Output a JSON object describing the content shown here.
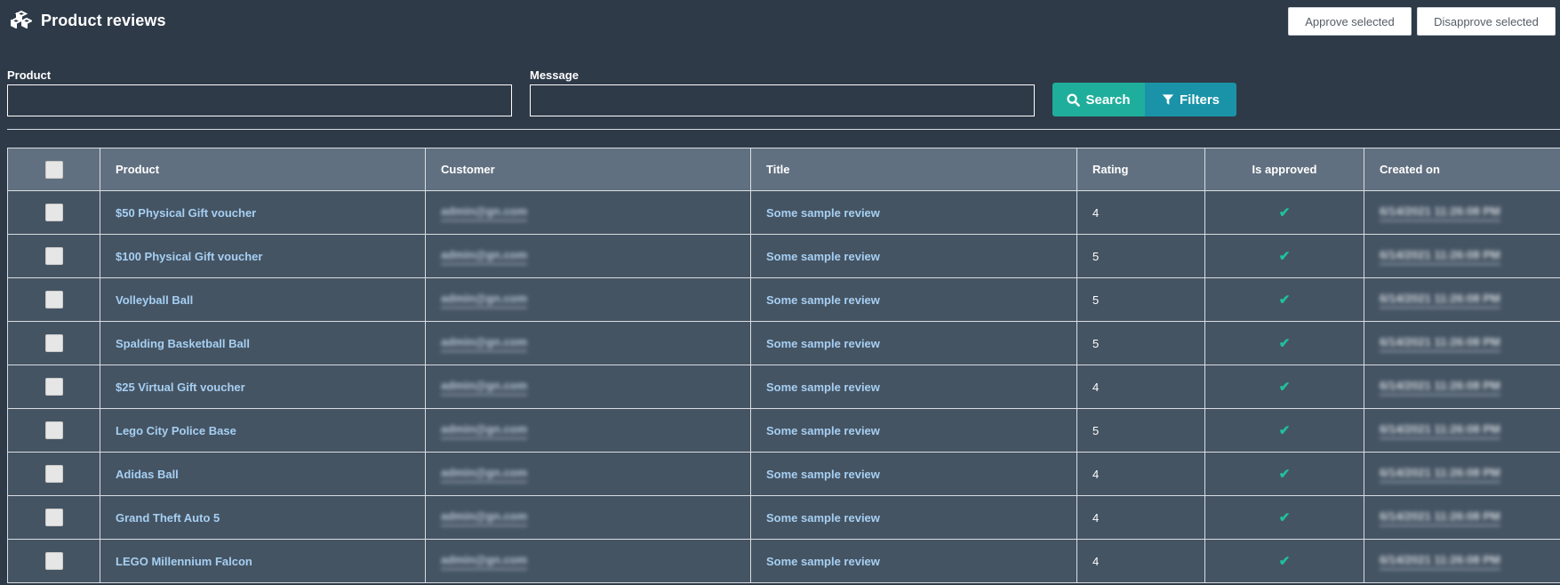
{
  "page": {
    "title": "Product reviews",
    "logo_icon": "cubes-icon"
  },
  "actions": {
    "approve_label": "Approve selected",
    "disapprove_label": "Disapprove selected"
  },
  "search": {
    "product_label": "Product",
    "product_value": "",
    "message_label": "Message",
    "message_value": "",
    "search_label": "Search",
    "filters_label": "Filters"
  },
  "colors": {
    "background": "#2e3a48",
    "header_row": "#617080",
    "body_row": "#455463",
    "search_button": "#1fae9c",
    "filters_button": "#1a93a8",
    "link": "#a6cff2",
    "approved_check": "#1fc19a"
  },
  "table": {
    "columns": [
      "Product",
      "Customer",
      "Title",
      "Rating",
      "Is approved",
      "Created on"
    ],
    "rows": [
      {
        "product": "$50 Physical Gift voucher",
        "customer": "admin@gn.com",
        "title": "Some sample review",
        "rating": "4",
        "approved": "✔",
        "created": "6/14/2021 11:26:08 PM"
      },
      {
        "product": "$100 Physical Gift voucher",
        "customer": "admin@gn.com",
        "title": "Some sample review",
        "rating": "5",
        "approved": "✔",
        "created": "6/14/2021 11:26:08 PM"
      },
      {
        "product": "Volleyball Ball",
        "customer": "admin@gn.com",
        "title": "Some sample review",
        "rating": "5",
        "approved": "✔",
        "created": "6/14/2021 11:26:08 PM"
      },
      {
        "product": "Spalding Basketball Ball",
        "customer": "admin@gn.com",
        "title": "Some sample review",
        "rating": "5",
        "approved": "✔",
        "created": "6/14/2021 11:26:08 PM"
      },
      {
        "product": "$25 Virtual Gift voucher",
        "customer": "admin@gn.com",
        "title": "Some sample review",
        "rating": "4",
        "approved": "✔",
        "created": "6/14/2021 11:26:08 PM"
      },
      {
        "product": "Lego City Police Base",
        "customer": "admin@gn.com",
        "title": "Some sample review",
        "rating": "5",
        "approved": "✔",
        "created": "6/14/2021 11:26:08 PM"
      },
      {
        "product": "Adidas Ball",
        "customer": "admin@gn.com",
        "title": "Some sample review",
        "rating": "4",
        "approved": "✔",
        "created": "6/14/2021 11:26:08 PM"
      },
      {
        "product": "Grand Theft Auto 5",
        "customer": "admin@gn.com",
        "title": "Some sample review",
        "rating": "4",
        "approved": "✔",
        "created": "6/14/2021 11:26:08 PM"
      },
      {
        "product": "LEGO Millennium Falcon",
        "customer": "admin@gn.com",
        "title": "Some sample review",
        "rating": "4",
        "approved": "✔",
        "created": "6/14/2021 11:26:08 PM"
      }
    ]
  }
}
